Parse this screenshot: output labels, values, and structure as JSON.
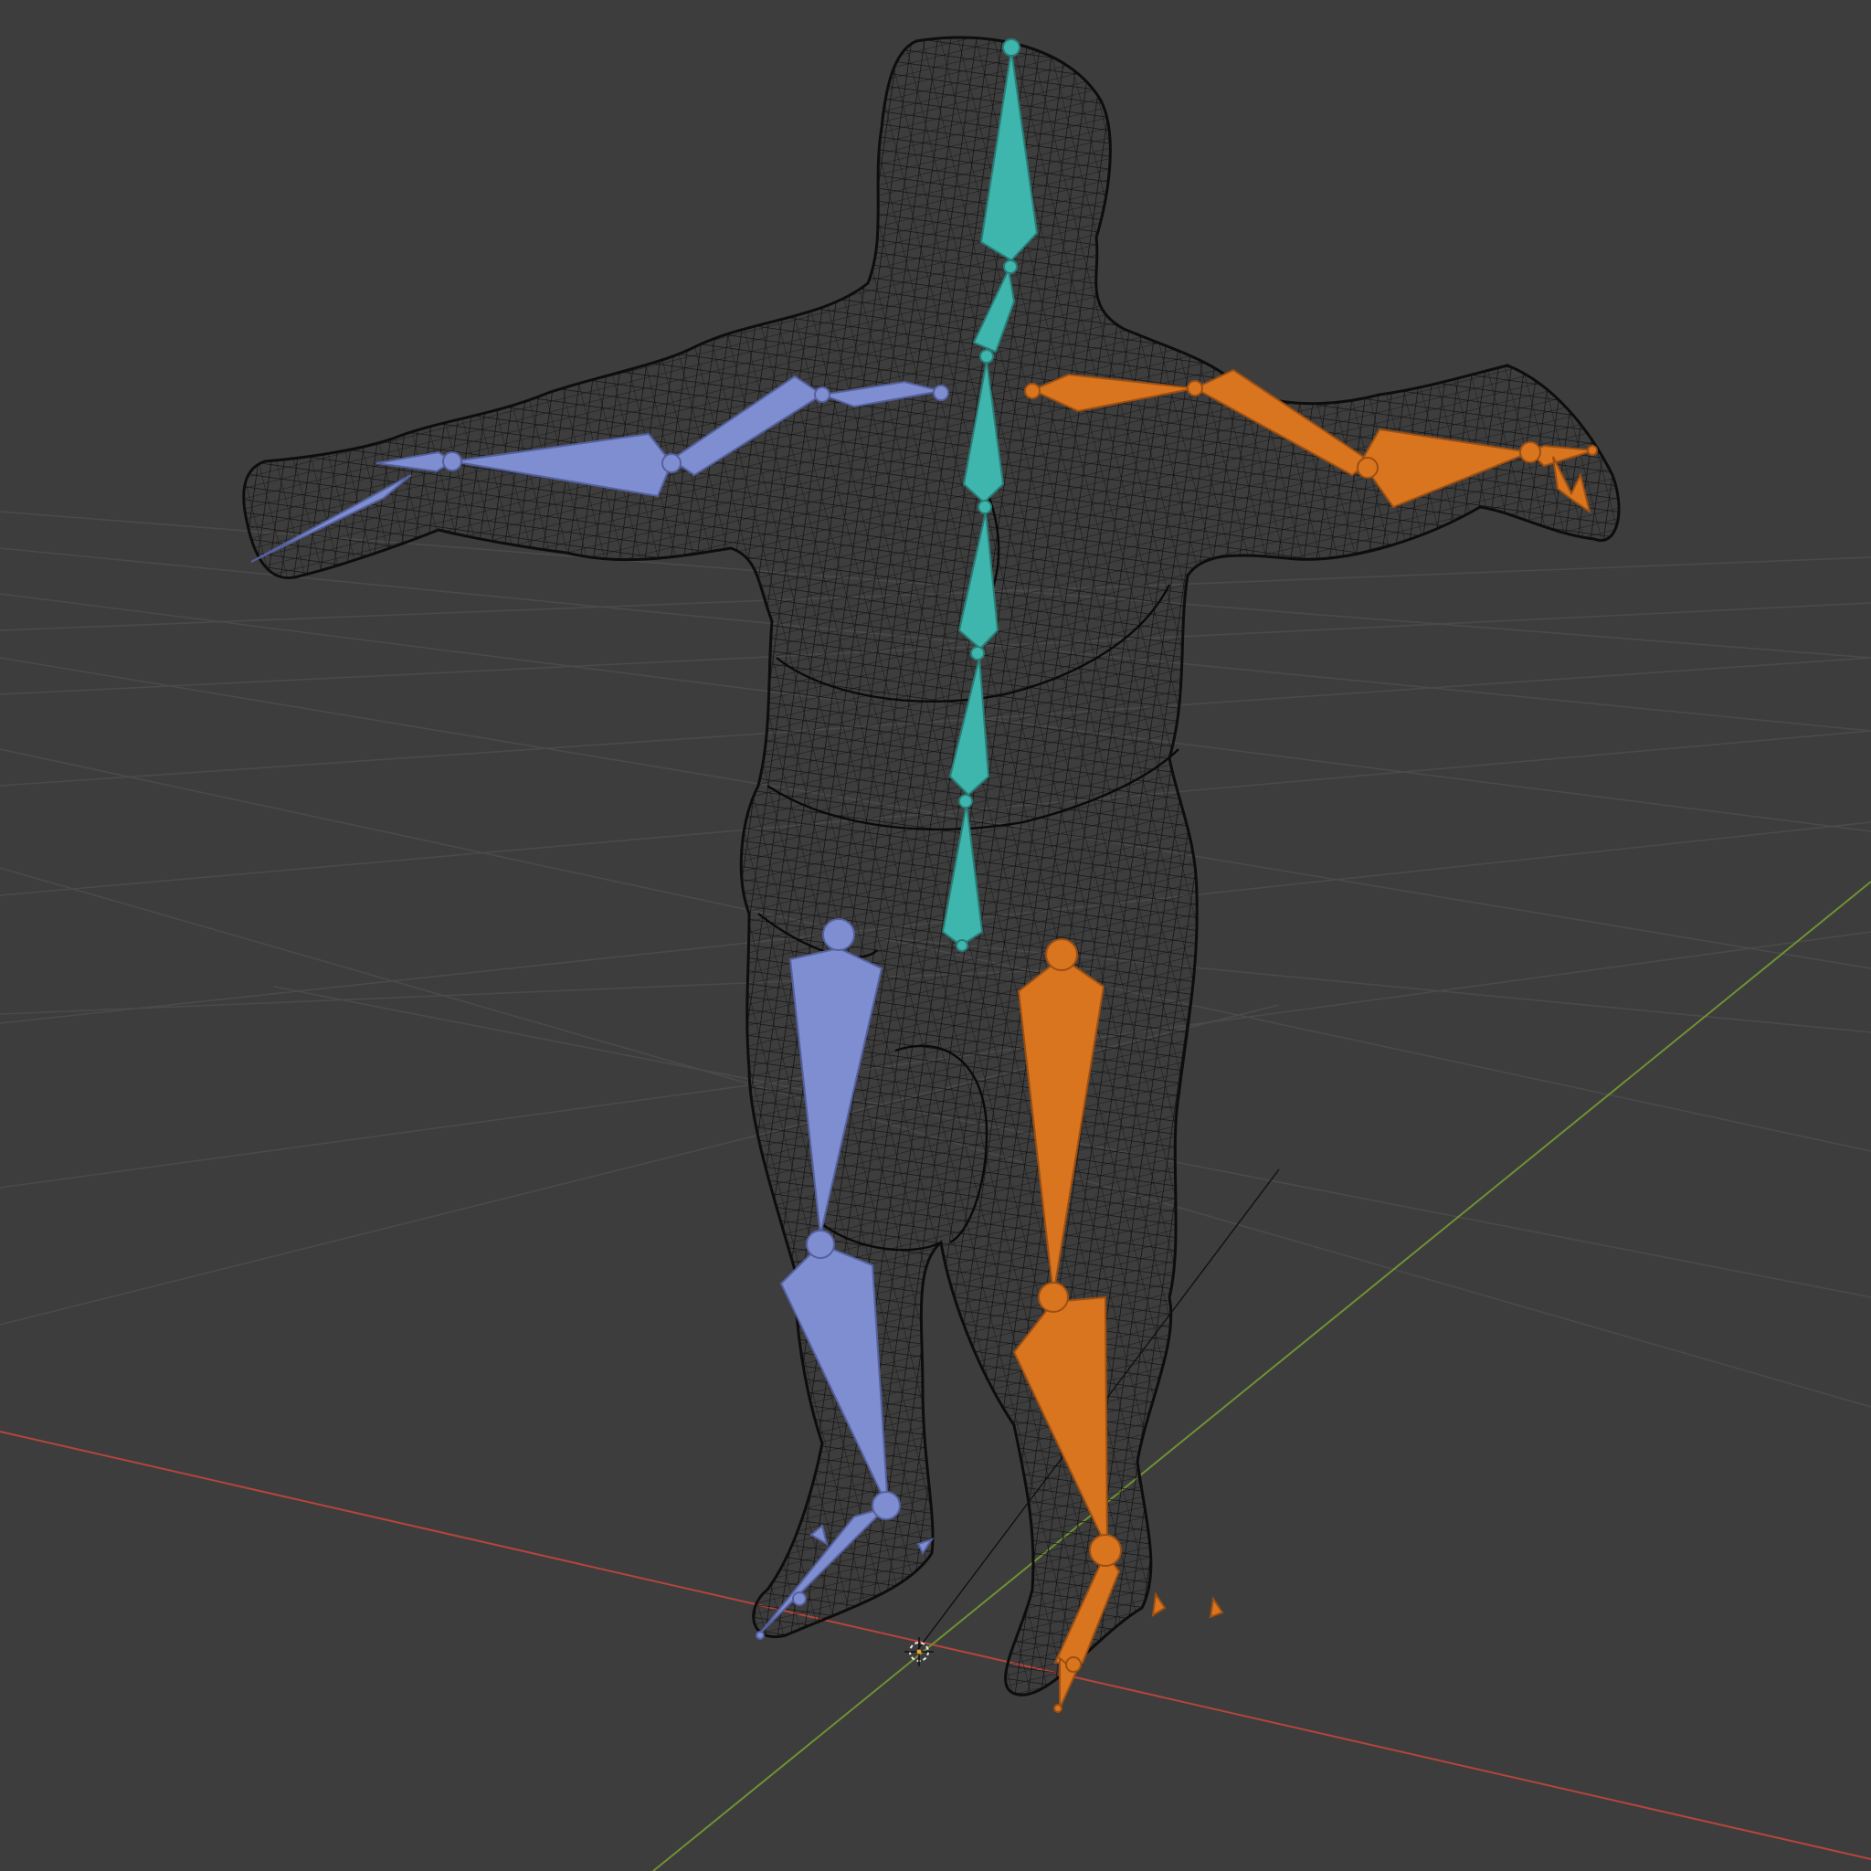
{
  "viewport": {
    "label": "",
    "background": "#3d3d3d",
    "grid_color": "#4a4a4a",
    "x_axis_color": "#b5453c",
    "y_axis_color": "#6f9132",
    "mesh_display": "wireframe",
    "mesh_color": "#0d0d0d"
  },
  "armature": {
    "colors": {
      "spine": "#3fb6ad",
      "left_side": "#7f8ed1",
      "right_side": "#d9741f"
    },
    "bone_groups": [
      "spine",
      "left_side",
      "right_side"
    ]
  },
  "scene_objects": [
    "character-mesh",
    "armature",
    "world-origin",
    "3d-cursor"
  ]
}
